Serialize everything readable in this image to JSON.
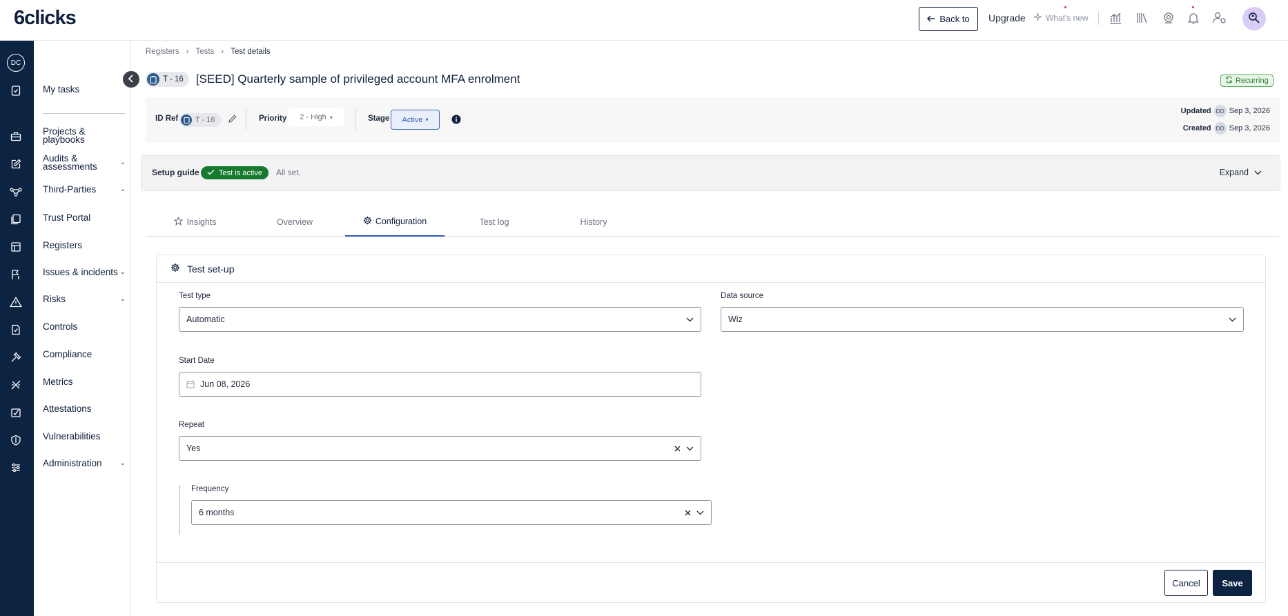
{
  "brand": {
    "logo_text": "6clicks"
  },
  "topbar": {
    "back_label": "Back to",
    "upgrade_label": "Upgrade",
    "whats_new_label": "What's new",
    "user_avatar_icon": "user-search-icon",
    "icons": [
      "analytics-icon",
      "library-icon",
      "support-icon",
      "bell-icon",
      "user-settings-icon"
    ]
  },
  "rail": {
    "avatar_initials": "DC",
    "icons": [
      "clipboard-check-icon",
      "briefcase-icon",
      "edit-icon",
      "network-icon",
      "portal-icon",
      "register-icon",
      "incident-icon",
      "warning-icon",
      "controls-icon",
      "compliance-icon",
      "metrics-icon",
      "attestation-icon",
      "shield-icon",
      "sliders-icon"
    ]
  },
  "sidebar": {
    "items": [
      {
        "label": "My tasks",
        "expandable": false
      },
      {
        "label": "Projects & playbooks",
        "expandable": false
      },
      {
        "label": "Audits & assessments",
        "expandable": true
      },
      {
        "label": "Third-Parties",
        "expandable": true
      },
      {
        "label": "Trust Portal",
        "expandable": false
      },
      {
        "label": "Registers",
        "expandable": false
      },
      {
        "label": "Issues & incidents",
        "expandable": true
      },
      {
        "label": "Risks",
        "expandable": true
      },
      {
        "label": "Controls",
        "expandable": false
      },
      {
        "label": "Compliance",
        "expandable": false
      },
      {
        "label": "Metrics",
        "expandable": false
      },
      {
        "label": "Attestations",
        "expandable": false
      },
      {
        "label": "Vulnerabilities",
        "expandable": false
      },
      {
        "label": "Administration",
        "expandable": true
      }
    ]
  },
  "breadcrumb": [
    "Registers",
    "Tests",
    "Test details"
  ],
  "header": {
    "id_badge": "T - 16",
    "title": "[SEED] Quarterly sample of privileged account MFA enrolment",
    "recurring_label": "Recurring"
  },
  "info": {
    "id_ref_label": "ID Ref",
    "id_ref_value": "T - 16",
    "priority_label": "Priority",
    "priority_value": "2 - High",
    "stage_label": "Stage",
    "stage_value": "Active",
    "updated_label": "Updated",
    "updated_user": "DD",
    "updated_date": "Sep 3, 2026",
    "created_label": "Created",
    "created_user": "DD",
    "created_date": "Sep 3, 2026"
  },
  "setup_guide": {
    "label": "Setup guide",
    "status": "Test is active",
    "note": "All set.",
    "expand_label": "Expand"
  },
  "tabs": [
    {
      "label": "Insights",
      "icon": "star-icon",
      "active": false
    },
    {
      "label": "Overview",
      "icon": "",
      "active": false
    },
    {
      "label": "Configuration",
      "icon": "gear-icon",
      "active": true
    },
    {
      "label": "Test log",
      "icon": "",
      "active": false
    },
    {
      "label": "History",
      "icon": "",
      "active": false
    }
  ],
  "form": {
    "section_title": "Test set-up",
    "test_type_label": "Test type",
    "test_type_value": "Automatic",
    "data_source_label": "Data source",
    "data_source_value": "Wiz",
    "start_date_label": "Start Date",
    "start_date_value": "Jun 08, 2026",
    "repeat_label": "Repeat",
    "repeat_value": "Yes",
    "frequency_label": "Frequency",
    "frequency_value": "6 months",
    "cancel_label": "Cancel",
    "save_label": "Save"
  },
  "colors": {
    "navy": "#0d2342",
    "accent_blue": "#2f5bb4",
    "success_green": "#157a2e",
    "recurring_green": "#2e7d32"
  }
}
